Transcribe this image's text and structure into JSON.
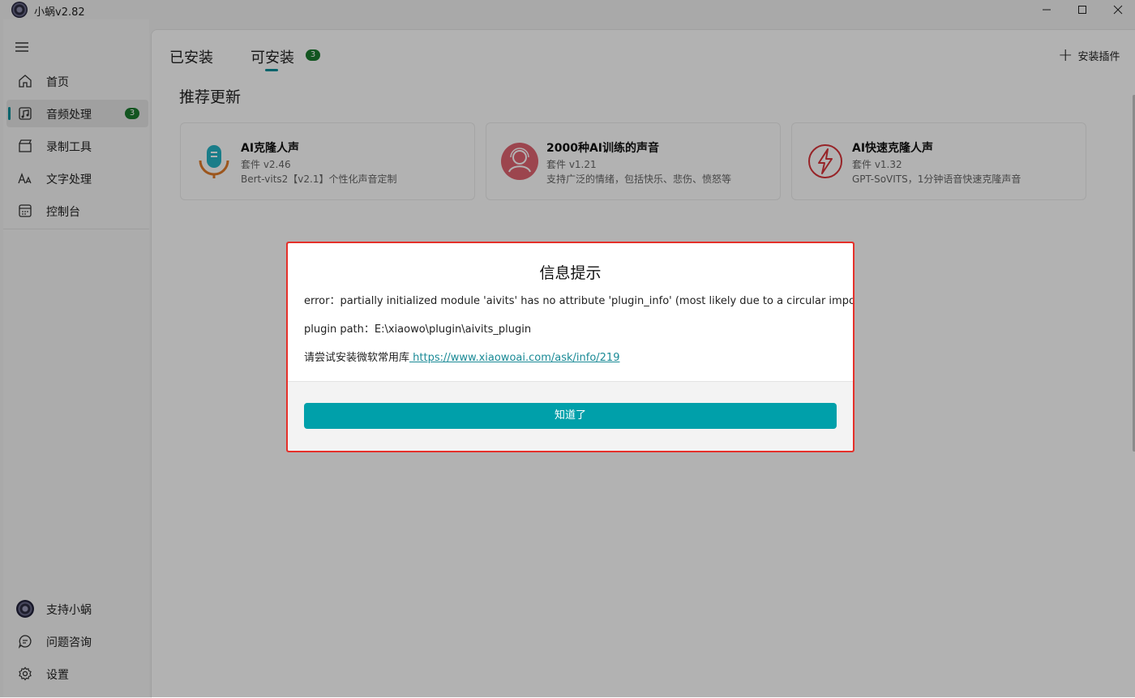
{
  "window": {
    "title": "小蜗v2.82",
    "logo_icon": "snail-logo-icon",
    "minimize_icon": "minimize-icon",
    "maximize_icon": "maximize-icon",
    "close_icon": "close-icon"
  },
  "sidebar": {
    "menu_icon": "hamburger-icon",
    "items": [
      {
        "label": "首页",
        "icon": "home-icon"
      },
      {
        "label": "音频处理",
        "icon": "audio-icon",
        "badge": "3",
        "active": true
      },
      {
        "label": "录制工具",
        "icon": "record-icon"
      },
      {
        "label": "文字处理",
        "icon": "text-icon"
      },
      {
        "label": "控制台",
        "icon": "console-icon"
      }
    ],
    "bottom_items": [
      {
        "label": "支持小蜗",
        "icon": "snail-avatar-icon"
      },
      {
        "label": "问题咨询",
        "icon": "chat-icon"
      },
      {
        "label": "设置",
        "icon": "gear-icon"
      }
    ]
  },
  "main": {
    "tabs": [
      {
        "label": "已安装"
      },
      {
        "label": "可安装",
        "badge": "3",
        "active": true
      }
    ],
    "install_plugin_label": "安装插件",
    "section_title": "推荐更新",
    "cards": [
      {
        "name": "AI克隆人声",
        "version": "套件 v2.46",
        "desc": "Bert-vits2【v2.1】个性化声音定制",
        "icon": "microphone-icon"
      },
      {
        "name": "2000种AI训练的声音",
        "version": "套件 v1.21",
        "desc": "支持广泛的情绪，包括快乐、悲伤、愤怒等",
        "icon": "voices-icon"
      },
      {
        "name": "AI快速克隆人声",
        "version": "套件 v1.32",
        "desc": "GPT-SoVITS，1分钟语音快速克隆声音",
        "icon": "lightning-icon"
      }
    ]
  },
  "dialog": {
    "title": "信息提示",
    "error_line": "error：partially initialized module 'aivits' has no attribute 'plugin_info' (most likely due to a circular import)",
    "path_line": "plugin path：E:\\xiaowo\\plugin\\aivits_plugin",
    "hint_prefix": "请尝试安装微软常用库",
    "hint_link": " https://www.xiaowoai.com/ask/info/219",
    "ok_label": "知道了"
  },
  "colors": {
    "accent": "#00a0aa",
    "badge": "#1a7a2e",
    "highlight_frame": "#e5302a"
  }
}
